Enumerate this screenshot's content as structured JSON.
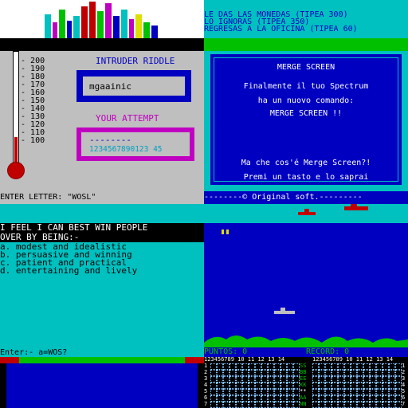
{
  "panel1": {
    "scale": [
      "200",
      "190",
      "180",
      "170",
      "160",
      "150",
      "140",
      "130",
      "120",
      "110",
      "100"
    ],
    "title": "INTRUDER RIDDLE",
    "word": "mgaainic",
    "attempt_label": "YOUR ATTEMPT",
    "attempt_dashes": "--------",
    "attempt_digits": "1234567890123 45",
    "status": "ENTER LETTER: \"WOSL\""
  },
  "panel2": {
    "top": [
      "LE DAS LAS MONEDAS (TIPEA 300)",
      "LO IGNORAS (TIPEA 350)",
      "REGRESAS A LA OFICINA (TIPEA 60)"
    ],
    "box_title": "MERGE SCREEN",
    "lines": [
      "Finalmente il tuo Spectrum",
      "ha un nuovo comando:",
      "MERGE SCREEN !!"
    ],
    "lines2": [
      "Ma che cos'é Merge Screen?!",
      "Premi un tasto e lo saprai"
    ],
    "footer": "--------© Original soft.---------"
  },
  "panel3": {
    "header": [
      "I FEEL I CAN BEST WIN PEOPLE",
      "OVER BY BEING:-"
    ],
    "options": [
      "a. modest and idealistic",
      "b. persuasive and winning",
      "c. patient and practical",
      "d. entertaining and lively"
    ],
    "prompt": "Enter:- a=WOS?"
  },
  "panel4": {
    "puntos": "PUNTOS: 0",
    "record": "RECORD: 0",
    "cols": "123456789 10 11 12 13 14",
    "rows": [
      "1",
      "2",
      "3",
      "4",
      "5",
      "6",
      "7"
    ],
    "rows_right": [
      "1",
      "2",
      "3",
      "4",
      "5",
      "6",
      "7"
    ],
    "letters": [
      "SS",
      "BB",
      "EE",
      "KK",
      "**",
      "AA",
      "NN"
    ]
  },
  "colors": {
    "bg": "#000000",
    "cyan": "#00c0c0",
    "blue": "#0000c0",
    "green": "#00c000",
    "red": "#c00000",
    "magenta": "#c000c0",
    "grey": "#bfbfbf"
  }
}
